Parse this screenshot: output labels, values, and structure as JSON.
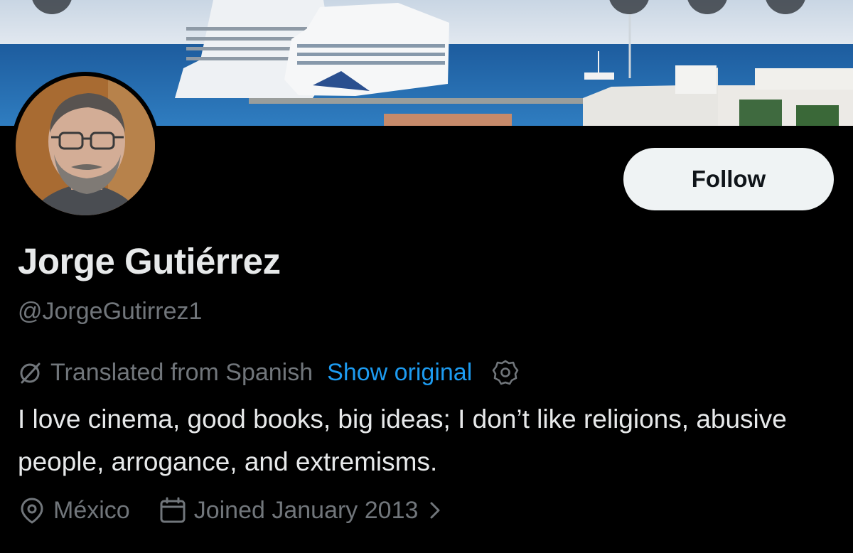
{
  "profile": {
    "display_name": "Jorge Gutiérrez",
    "handle": "@JorgeGutirrez1",
    "follow_label": "Follow"
  },
  "translation": {
    "notice": "Translated from Spanish",
    "show_original": "Show original"
  },
  "bio": "I love cinema, good books, big ideas; I don’t like religions, abusive people, arrogance, and extremisms.",
  "meta": {
    "location": "México",
    "joined": "Joined January 2013"
  },
  "colors": {
    "background": "#000000",
    "primary_text": "#e7e9ea",
    "secondary_text": "#71767b",
    "link": "#1d9bf0",
    "follow_button_bg": "#eff3f4",
    "follow_button_text": "#0f1419"
  },
  "icons": [
    "translate-icon",
    "gear-icon",
    "location-pin-icon",
    "calendar-icon",
    "chevron-right-icon"
  ]
}
